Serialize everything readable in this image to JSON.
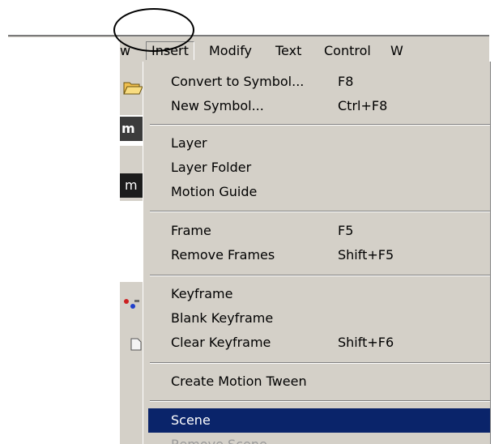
{
  "menubar": {
    "items": [
      {
        "label": "w"
      },
      {
        "label": "Insert"
      },
      {
        "label": "Modify"
      },
      {
        "label": "Text"
      },
      {
        "label": "Control"
      },
      {
        "label": "W"
      }
    ]
  },
  "side_panel": {
    "strip_text_1": "m",
    "strip_text_2": "m"
  },
  "insert_menu": {
    "items": [
      {
        "label": "Convert to Symbol...",
        "shortcut": "F8"
      },
      {
        "label": "New Symbol...",
        "shortcut": "Ctrl+F8"
      },
      {
        "label": "Layer",
        "shortcut": ""
      },
      {
        "label": "Layer Folder",
        "shortcut": ""
      },
      {
        "label": "Motion Guide",
        "shortcut": ""
      },
      {
        "label": "Frame",
        "shortcut": "F5"
      },
      {
        "label": "Remove Frames",
        "shortcut": "Shift+F5"
      },
      {
        "label": "Keyframe",
        "shortcut": ""
      },
      {
        "label": "Blank Keyframe",
        "shortcut": ""
      },
      {
        "label": "Clear Keyframe",
        "shortcut": "Shift+F6"
      },
      {
        "label": "Create Motion Tween",
        "shortcut": ""
      },
      {
        "label": "Scene",
        "shortcut": "",
        "state": "highlighted"
      },
      {
        "label": "Remove Scene",
        "shortcut": "",
        "state": "disabled"
      }
    ]
  },
  "colors": {
    "menu_bg": "#d4d0c8",
    "highlight": "#0a246a",
    "annotation_circle": "#000000"
  },
  "icons": [
    "folder-open-icon",
    "tools-icon",
    "document-icon"
  ]
}
